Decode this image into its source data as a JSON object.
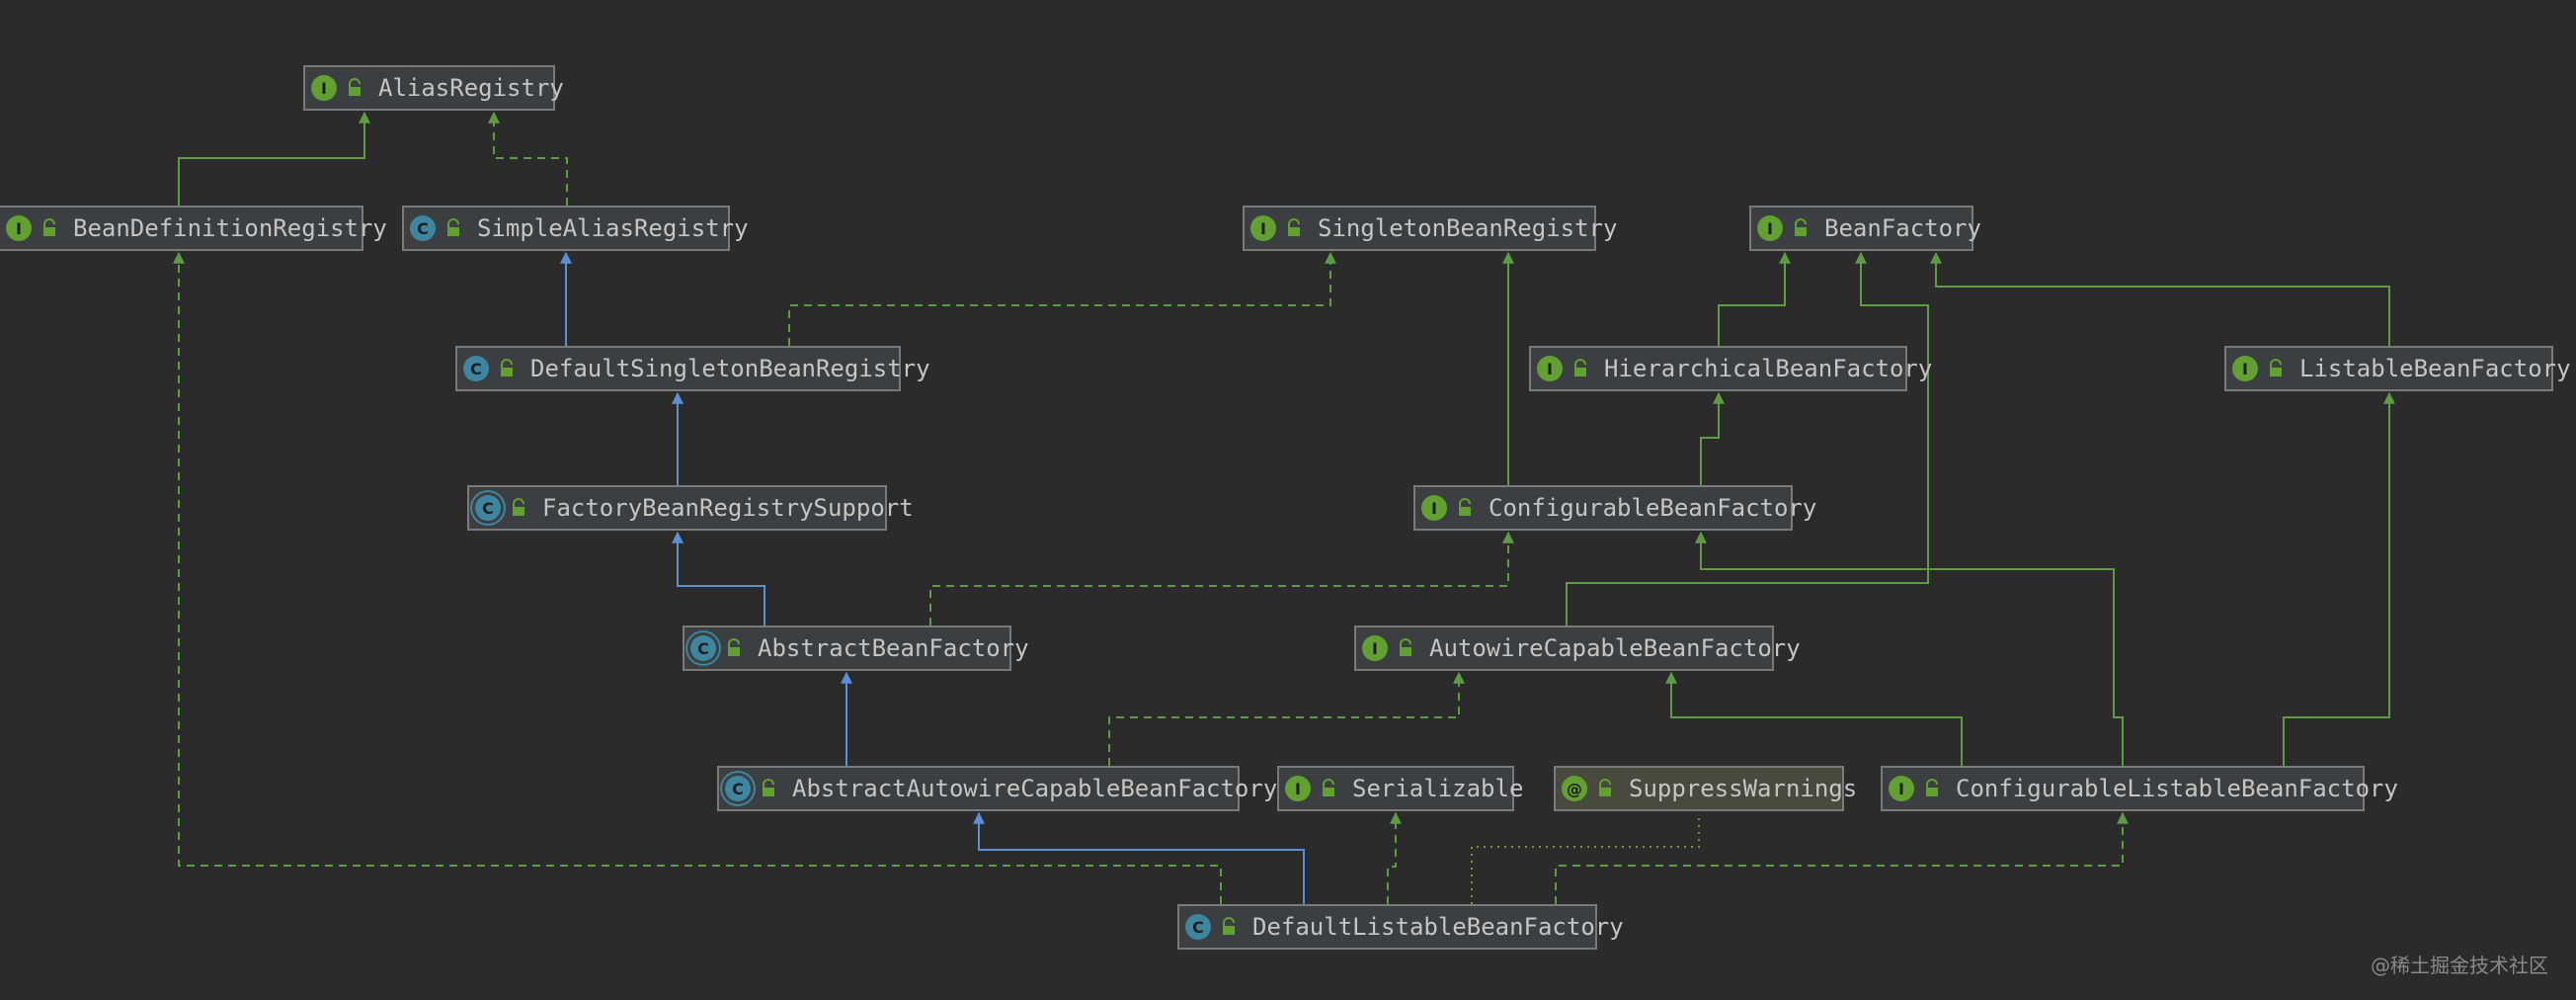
{
  "colors": {
    "background": "#2b2b2b",
    "interface_badge": "#62a032",
    "class_badge": "#3e86a0",
    "annotation_badge": "#62a032",
    "extends_arrow": "#5b8fd8",
    "implements_arrow": "#5d9c45"
  },
  "nodes": [
    {
      "id": "alias-registry",
      "label": "AliasRegistry",
      "kind": "interface",
      "badge": "I"
    },
    {
      "id": "bean-definition-registry",
      "label": "BeanDefinitionRegistry",
      "kind": "interface",
      "badge": "I"
    },
    {
      "id": "simple-alias-registry",
      "label": "SimpleAliasRegistry",
      "kind": "class",
      "badge": "C"
    },
    {
      "id": "singleton-bean-registry",
      "label": "SingletonBeanRegistry",
      "kind": "interface",
      "badge": "I"
    },
    {
      "id": "bean-factory",
      "label": "BeanFactory",
      "kind": "interface",
      "badge": "I"
    },
    {
      "id": "default-singleton-bean-registry",
      "label": "DefaultSingletonBeanRegistry",
      "kind": "class",
      "badge": "C"
    },
    {
      "id": "hierarchical-bean-factory",
      "label": "HierarchicalBeanFactory",
      "kind": "interface",
      "badge": "I"
    },
    {
      "id": "listable-bean-factory",
      "label": "ListableBeanFactory",
      "kind": "interface",
      "badge": "I"
    },
    {
      "id": "factory-bean-registry-support",
      "label": "FactoryBeanRegistrySupport",
      "kind": "abstract",
      "badge": "C"
    },
    {
      "id": "configurable-bean-factory",
      "label": "ConfigurableBeanFactory",
      "kind": "interface",
      "badge": "I"
    },
    {
      "id": "abstract-bean-factory",
      "label": "AbstractBeanFactory",
      "kind": "abstract",
      "badge": "C"
    },
    {
      "id": "autowire-capable-bean-factory",
      "label": "AutowireCapableBeanFactory",
      "kind": "interface",
      "badge": "I"
    },
    {
      "id": "abstract-autowire-capable-bean-factory",
      "label": "AbstractAutowireCapableBeanFactory",
      "kind": "abstract",
      "badge": "C"
    },
    {
      "id": "serializable",
      "label": "Serializable",
      "kind": "interface",
      "badge": "I"
    },
    {
      "id": "suppress-warnings",
      "label": "SuppressWarnings",
      "kind": "annotation",
      "badge": "@"
    },
    {
      "id": "configurable-listable-bean-factory",
      "label": "ConfigurableListableBeanFactory",
      "kind": "interface",
      "badge": "I"
    },
    {
      "id": "default-listable-bean-factory",
      "label": "DefaultListableBeanFactory",
      "kind": "class",
      "badge": "C"
    }
  ],
  "edges": [
    {
      "from": "bean-definition-registry",
      "to": "alias-registry",
      "type": "interface-extends"
    },
    {
      "from": "simple-alias-registry",
      "to": "alias-registry",
      "type": "implements"
    },
    {
      "from": "default-singleton-bean-registry",
      "to": "simple-alias-registry",
      "type": "extends"
    },
    {
      "from": "default-singleton-bean-registry",
      "to": "singleton-bean-registry",
      "type": "implements"
    },
    {
      "from": "factory-bean-registry-support",
      "to": "default-singleton-bean-registry",
      "type": "extends"
    },
    {
      "from": "abstract-bean-factory",
      "to": "factory-bean-registry-support",
      "type": "extends"
    },
    {
      "from": "abstract-bean-factory",
      "to": "configurable-bean-factory",
      "type": "implements"
    },
    {
      "from": "hierarchical-bean-factory",
      "to": "bean-factory",
      "type": "interface-extends"
    },
    {
      "from": "listable-bean-factory",
      "to": "bean-factory",
      "type": "interface-extends"
    },
    {
      "from": "configurable-bean-factory",
      "to": "hierarchical-bean-factory",
      "type": "interface-extends"
    },
    {
      "from": "configurable-bean-factory",
      "to": "singleton-bean-registry",
      "type": "interface-extends"
    },
    {
      "from": "autowire-capable-bean-factory",
      "to": "bean-factory",
      "type": "interface-extends"
    },
    {
      "from": "abstract-autowire-capable-bean-factory",
      "to": "abstract-bean-factory",
      "type": "extends"
    },
    {
      "from": "abstract-autowire-capable-bean-factory",
      "to": "autowire-capable-bean-factory",
      "type": "implements"
    },
    {
      "from": "configurable-listable-bean-factory",
      "to": "autowire-capable-bean-factory",
      "type": "interface-extends"
    },
    {
      "from": "configurable-listable-bean-factory",
      "to": "configurable-bean-factory",
      "type": "interface-extends"
    },
    {
      "from": "configurable-listable-bean-factory",
      "to": "listable-bean-factory",
      "type": "interface-extends"
    },
    {
      "from": "default-listable-bean-factory",
      "to": "abstract-autowire-capable-bean-factory",
      "type": "extends"
    },
    {
      "from": "default-listable-bean-factory",
      "to": "bean-definition-registry",
      "type": "implements"
    },
    {
      "from": "default-listable-bean-factory",
      "to": "serializable",
      "type": "implements"
    },
    {
      "from": "default-listable-bean-factory",
      "to": "configurable-listable-bean-factory",
      "type": "implements"
    },
    {
      "from": "default-listable-bean-factory",
      "to": "suppress-warnings",
      "type": "annotated-with"
    }
  ],
  "watermark": "@稀土掘金技术社区"
}
